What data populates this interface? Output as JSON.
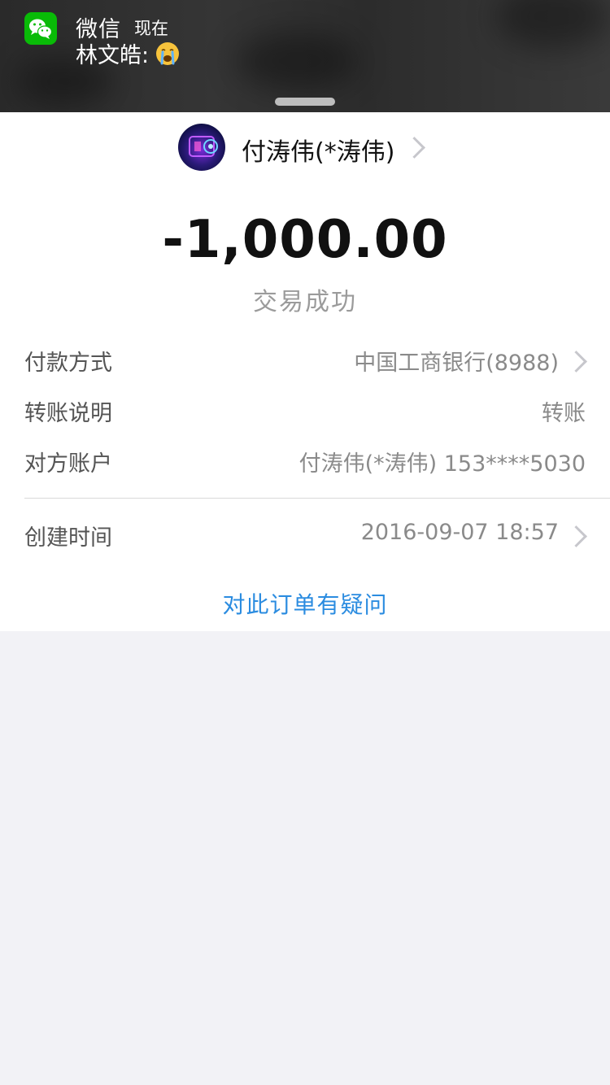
{
  "notification": {
    "app_name": "微信",
    "time": "现在",
    "message": "林文皓:",
    "emoji": "crying-face-icon",
    "app_icon": "wechat-icon",
    "background_color": "#2f2f2f"
  },
  "transaction": {
    "payee_name": "付涛伟(*涛伟)",
    "amount": "-1,000.00",
    "status": "交易成功"
  },
  "details": {
    "payment_method_label": "付款方式",
    "payment_method_value": "中国工商银行(8988)",
    "transfer_note_label": "转账说明",
    "transfer_note_value": "转账",
    "counterparty_label": "对方账户",
    "counterparty_value": "付涛伟(*涛伟) 153****5030",
    "created_time_label": "创建时间",
    "created_time_value": "2016-09-07 18:57"
  },
  "actions": {
    "question_link": "对此订单有疑问"
  },
  "colors": {
    "link": "#2b8ce0",
    "wechat_green": "#09bb07",
    "page_background": "#f2f2f6",
    "label_gray": "#555555",
    "value_gray": "#8a8a8a"
  }
}
